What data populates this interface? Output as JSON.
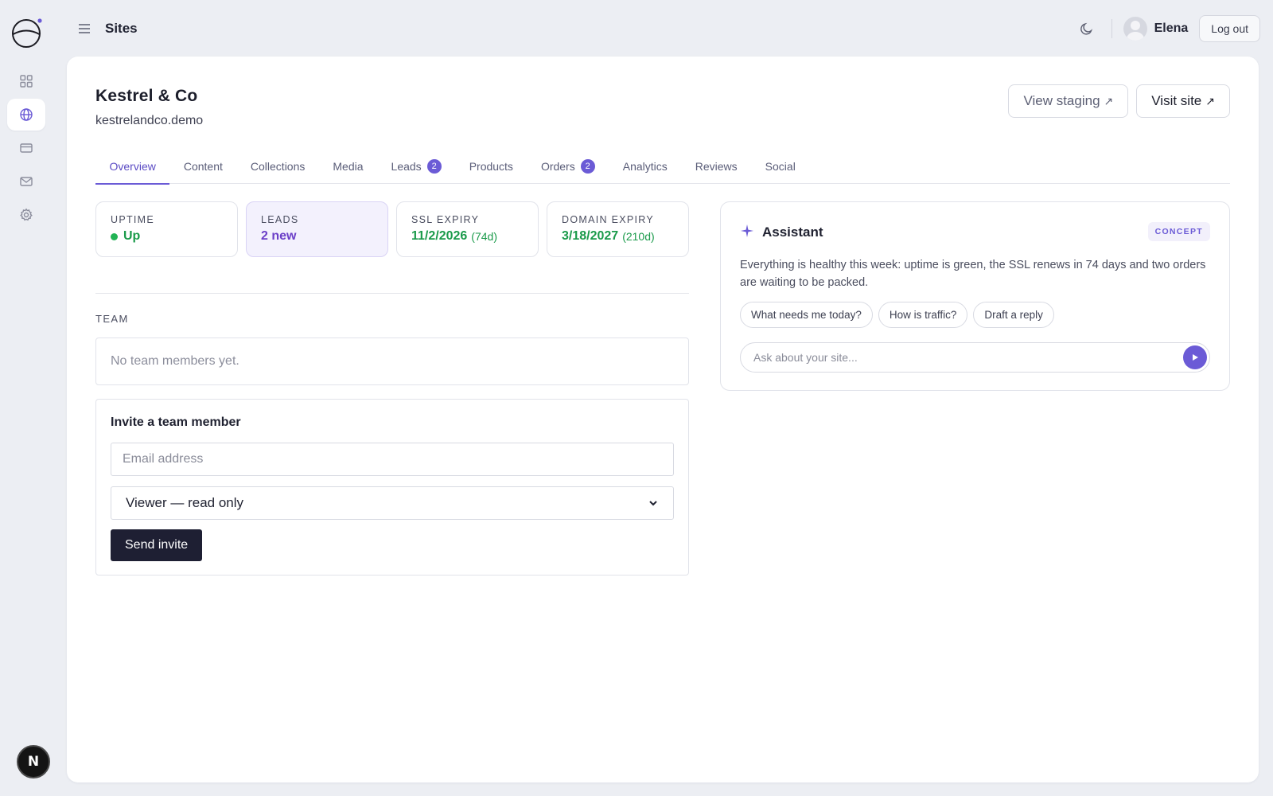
{
  "topbar": {
    "title": "Sites",
    "user_name": "Elena",
    "logout_label": "Log out"
  },
  "site": {
    "name": "Kestrel & Co",
    "domain": "kestrelandco.demo",
    "view_staging_label": "View staging",
    "visit_site_label": "Visit site"
  },
  "tabs": [
    {
      "label": "Overview"
    },
    {
      "label": "Content"
    },
    {
      "label": "Collections"
    },
    {
      "label": "Media"
    },
    {
      "label": "Leads",
      "badge": "2"
    },
    {
      "label": "Products"
    },
    {
      "label": "Orders",
      "badge": "2"
    },
    {
      "label": "Analytics"
    },
    {
      "label": "Reviews"
    },
    {
      "label": "Social"
    }
  ],
  "stats": {
    "uptime": {
      "label": "UPTIME",
      "value": "Up"
    },
    "leads": {
      "label": "LEADS",
      "value": "2 new"
    },
    "ssl": {
      "label": "SSL EXPIRY",
      "value": "11/2/2026",
      "sub": "(74d)"
    },
    "domain": {
      "label": "DOMAIN EXPIRY",
      "value": "3/18/2027",
      "sub": "(210d)"
    }
  },
  "team": {
    "heading": "TEAM",
    "empty_text": "No team members yet.",
    "invite_title": "Invite a team member",
    "email_placeholder": "Email address",
    "role_value": "Viewer — read only",
    "send_label": "Send invite"
  },
  "assistant": {
    "title": "Assistant",
    "badge": "CONCEPT",
    "message": "Everything is healthy this week: uptime is green, the SSL renews in 74 days and two orders are waiting to be packed.",
    "chips": [
      "What needs me today?",
      "How is traffic?",
      "Draft a reply"
    ],
    "input_placeholder": "Ask about your site..."
  },
  "sidebar": {
    "avatar_letter": "N"
  },
  "colors": {
    "accent": "#6b5bd6",
    "success": "#1a9a4a",
    "dark_button": "#1e1f33"
  }
}
